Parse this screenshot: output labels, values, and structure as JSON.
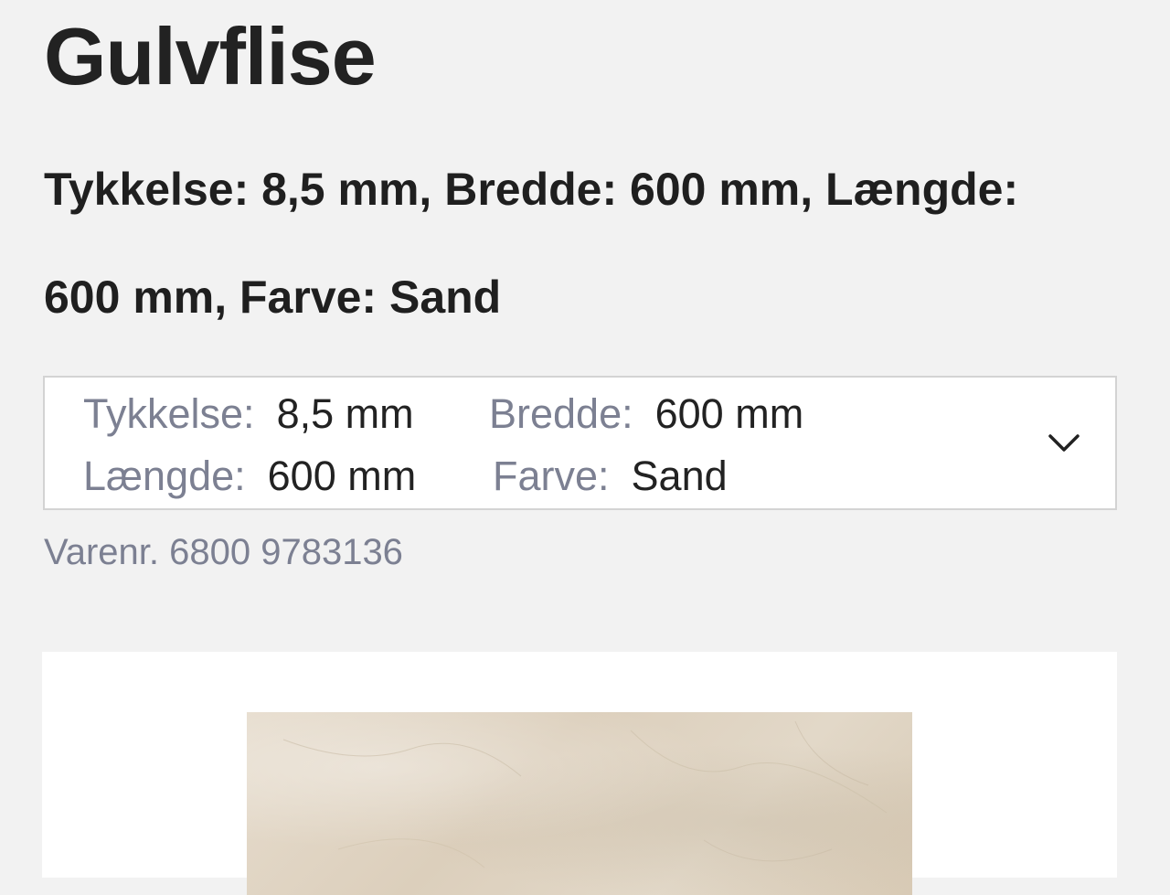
{
  "product": {
    "title": "Gulvflise",
    "subtitle": "Tykkelse: 8,5 mm, Bredde: 600 mm, Længde: 600 mm, Farve: Sand",
    "sku": "Varenr. 6800 9783136"
  },
  "variant_selector": {
    "specs": [
      {
        "label": "Tykkelse:",
        "value": "8,5 mm"
      },
      {
        "label": "Bredde:",
        "value": "600 mm"
      },
      {
        "label": "Længde:",
        "value": "600 mm"
      },
      {
        "label": "Farve:",
        "value": "Sand"
      }
    ],
    "icon": "chevron-down-icon"
  },
  "image": {
    "icon": "tile-image",
    "tile_color": "#e2d8c8"
  }
}
